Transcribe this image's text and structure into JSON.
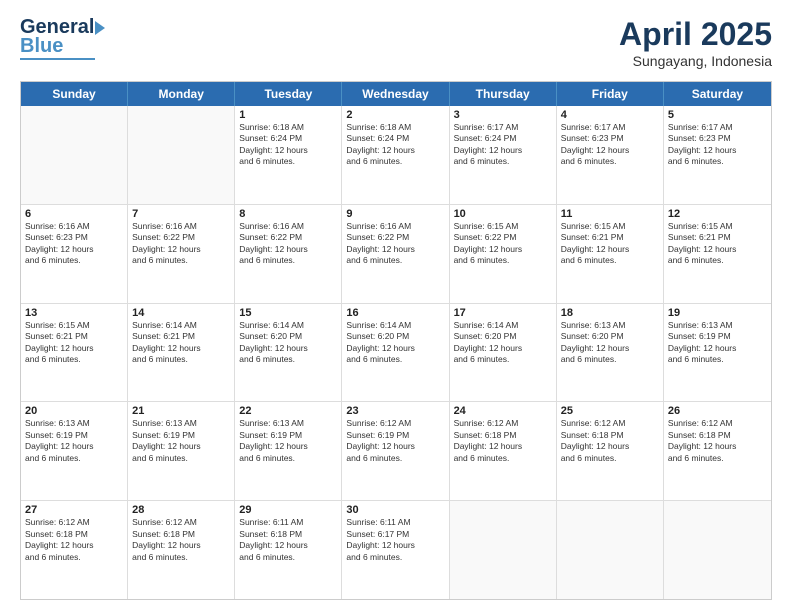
{
  "header": {
    "logo_line1": "General",
    "logo_line2": "Blue",
    "month": "April 2025",
    "location": "Sungayang, Indonesia"
  },
  "days": [
    "Sunday",
    "Monday",
    "Tuesday",
    "Wednesday",
    "Thursday",
    "Friday",
    "Saturday"
  ],
  "rows": [
    [
      {
        "day": "",
        "info": ""
      },
      {
        "day": "",
        "info": ""
      },
      {
        "day": "1",
        "info": "Sunrise: 6:18 AM\nSunset: 6:24 PM\nDaylight: 12 hours\nand 6 minutes."
      },
      {
        "day": "2",
        "info": "Sunrise: 6:18 AM\nSunset: 6:24 PM\nDaylight: 12 hours\nand 6 minutes."
      },
      {
        "day": "3",
        "info": "Sunrise: 6:17 AM\nSunset: 6:24 PM\nDaylight: 12 hours\nand 6 minutes."
      },
      {
        "day": "4",
        "info": "Sunrise: 6:17 AM\nSunset: 6:23 PM\nDaylight: 12 hours\nand 6 minutes."
      },
      {
        "day": "5",
        "info": "Sunrise: 6:17 AM\nSunset: 6:23 PM\nDaylight: 12 hours\nand 6 minutes."
      }
    ],
    [
      {
        "day": "6",
        "info": "Sunrise: 6:16 AM\nSunset: 6:23 PM\nDaylight: 12 hours\nand 6 minutes."
      },
      {
        "day": "7",
        "info": "Sunrise: 6:16 AM\nSunset: 6:22 PM\nDaylight: 12 hours\nand 6 minutes."
      },
      {
        "day": "8",
        "info": "Sunrise: 6:16 AM\nSunset: 6:22 PM\nDaylight: 12 hours\nand 6 minutes."
      },
      {
        "day": "9",
        "info": "Sunrise: 6:16 AM\nSunset: 6:22 PM\nDaylight: 12 hours\nand 6 minutes."
      },
      {
        "day": "10",
        "info": "Sunrise: 6:15 AM\nSunset: 6:22 PM\nDaylight: 12 hours\nand 6 minutes."
      },
      {
        "day": "11",
        "info": "Sunrise: 6:15 AM\nSunset: 6:21 PM\nDaylight: 12 hours\nand 6 minutes."
      },
      {
        "day": "12",
        "info": "Sunrise: 6:15 AM\nSunset: 6:21 PM\nDaylight: 12 hours\nand 6 minutes."
      }
    ],
    [
      {
        "day": "13",
        "info": "Sunrise: 6:15 AM\nSunset: 6:21 PM\nDaylight: 12 hours\nand 6 minutes."
      },
      {
        "day": "14",
        "info": "Sunrise: 6:14 AM\nSunset: 6:21 PM\nDaylight: 12 hours\nand 6 minutes."
      },
      {
        "day": "15",
        "info": "Sunrise: 6:14 AM\nSunset: 6:20 PM\nDaylight: 12 hours\nand 6 minutes."
      },
      {
        "day": "16",
        "info": "Sunrise: 6:14 AM\nSunset: 6:20 PM\nDaylight: 12 hours\nand 6 minutes."
      },
      {
        "day": "17",
        "info": "Sunrise: 6:14 AM\nSunset: 6:20 PM\nDaylight: 12 hours\nand 6 minutes."
      },
      {
        "day": "18",
        "info": "Sunrise: 6:13 AM\nSunset: 6:20 PM\nDaylight: 12 hours\nand 6 minutes."
      },
      {
        "day": "19",
        "info": "Sunrise: 6:13 AM\nSunset: 6:19 PM\nDaylight: 12 hours\nand 6 minutes."
      }
    ],
    [
      {
        "day": "20",
        "info": "Sunrise: 6:13 AM\nSunset: 6:19 PM\nDaylight: 12 hours\nand 6 minutes."
      },
      {
        "day": "21",
        "info": "Sunrise: 6:13 AM\nSunset: 6:19 PM\nDaylight: 12 hours\nand 6 minutes."
      },
      {
        "day": "22",
        "info": "Sunrise: 6:13 AM\nSunset: 6:19 PM\nDaylight: 12 hours\nand 6 minutes."
      },
      {
        "day": "23",
        "info": "Sunrise: 6:12 AM\nSunset: 6:19 PM\nDaylight: 12 hours\nand 6 minutes."
      },
      {
        "day": "24",
        "info": "Sunrise: 6:12 AM\nSunset: 6:18 PM\nDaylight: 12 hours\nand 6 minutes."
      },
      {
        "day": "25",
        "info": "Sunrise: 6:12 AM\nSunset: 6:18 PM\nDaylight: 12 hours\nand 6 minutes."
      },
      {
        "day": "26",
        "info": "Sunrise: 6:12 AM\nSunset: 6:18 PM\nDaylight: 12 hours\nand 6 minutes."
      }
    ],
    [
      {
        "day": "27",
        "info": "Sunrise: 6:12 AM\nSunset: 6:18 PM\nDaylight: 12 hours\nand 6 minutes."
      },
      {
        "day": "28",
        "info": "Sunrise: 6:12 AM\nSunset: 6:18 PM\nDaylight: 12 hours\nand 6 minutes."
      },
      {
        "day": "29",
        "info": "Sunrise: 6:11 AM\nSunset: 6:18 PM\nDaylight: 12 hours\nand 6 minutes."
      },
      {
        "day": "30",
        "info": "Sunrise: 6:11 AM\nSunset: 6:17 PM\nDaylight: 12 hours\nand 6 minutes."
      },
      {
        "day": "",
        "info": ""
      },
      {
        "day": "",
        "info": ""
      },
      {
        "day": "",
        "info": ""
      }
    ]
  ]
}
